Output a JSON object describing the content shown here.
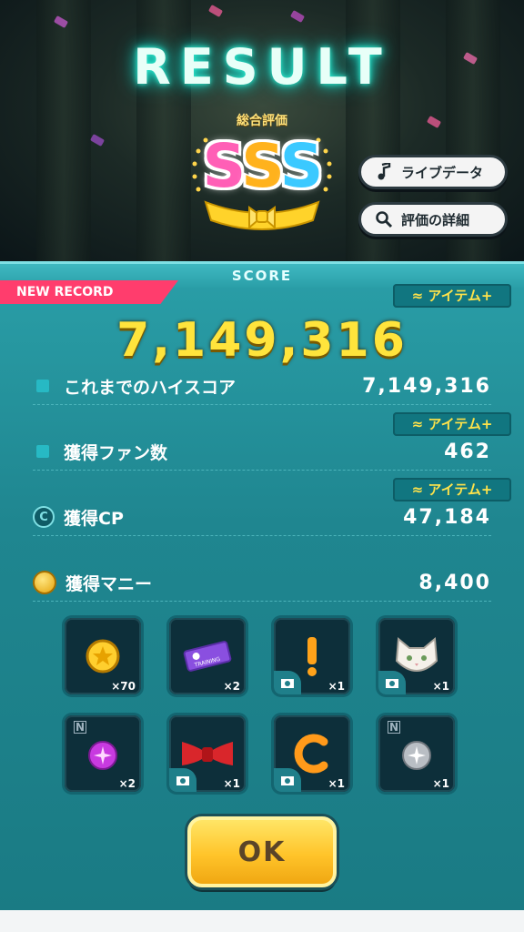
{
  "header": {
    "title": "RESULT",
    "rating_label": "総合評価",
    "rank": [
      "S",
      "S",
      "S"
    ]
  },
  "buttons": {
    "live_data": "ライブデータ",
    "rating_detail": "評価の詳細",
    "ok": "OK"
  },
  "panel": {
    "score_heading": "SCORE",
    "new_record": "NEW RECORD",
    "item_plus": "アイテム+",
    "score": "7,149,316",
    "rows": [
      {
        "label": "これまでのハイスコア",
        "value": "7,149,316"
      },
      {
        "label": "獲得ファン数",
        "value": "462"
      },
      {
        "label": "獲得CP",
        "value": "47,184",
        "icon_text": "C"
      },
      {
        "label": "獲得マニー",
        "value": "8,400"
      }
    ]
  },
  "rewards": [
    {
      "name": "gold-coin",
      "qty": "×70"
    },
    {
      "name": "training-ticket",
      "qty": "×2",
      "ticket_text": "TRAINING"
    },
    {
      "name": "exclamation",
      "qty": "×1"
    },
    {
      "name": "white-cat",
      "qty": "×1"
    },
    {
      "name": "purple-gem",
      "qty": "×2",
      "rarity": "N"
    },
    {
      "name": "red-bow",
      "qty": "×1"
    },
    {
      "name": "orange-c",
      "qty": "×1"
    },
    {
      "name": "silver-gem",
      "qty": "×1",
      "rarity": "N"
    }
  ],
  "colors": {
    "accent_teal": "#2a9fa8",
    "score_gold": "#ffe43c",
    "new_record_pink": "#ff3d6d",
    "ok_yellow": "#ffc42a"
  }
}
